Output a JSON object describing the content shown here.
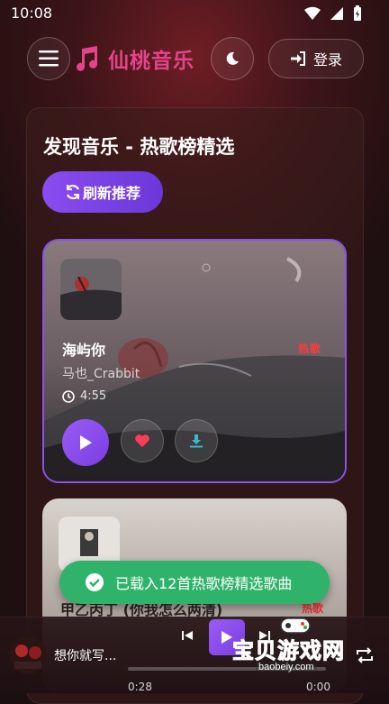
{
  "status_bar": {
    "time": "10:08"
  },
  "header": {
    "app_name": "仙桃音乐",
    "login_label": "登录"
  },
  "section": {
    "title": "发现音乐 - 热歌榜精选",
    "refresh_label": "刷新推荐"
  },
  "songs": [
    {
      "title": "海屿你",
      "artist": "马也_Crabbit",
      "duration": "4:55",
      "badge": "热歌"
    },
    {
      "title": "甲乙丙丁 (你我怎么两清)",
      "badge": "热歌"
    }
  ],
  "toast": {
    "message": "已载入12首热歌榜精选歌曲"
  },
  "player": {
    "title": "想你就写...",
    "current_time": "0:28",
    "total_time": "0:00",
    "progress": 0.0
  },
  "watermark": {
    "text": "宝贝游戏网",
    "url": "baobeiy.com"
  },
  "colors": {
    "accent_purple": "#8a52e8",
    "logo_pink": "#e4448a",
    "toast_green": "#2fb36a",
    "badge_red": "#ff3b3b",
    "like_red": "#ff3b5c",
    "download_teal": "#3fb6c8"
  }
}
